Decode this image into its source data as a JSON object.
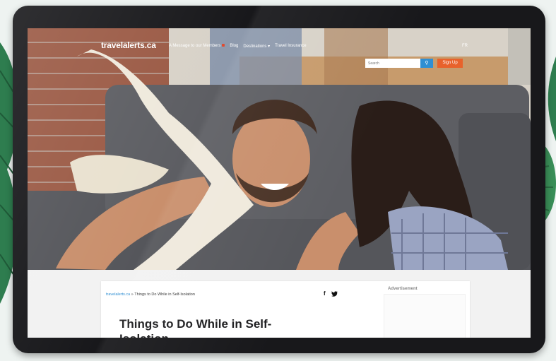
{
  "site": {
    "logo_text": "travelalerts.ca",
    "nav_links": [
      "A Message to our Members",
      "Blog",
      "Destinations",
      "Travel Insurance"
    ],
    "language": "FR",
    "search_placeholder": "Search",
    "search_icon": "magnifier-icon",
    "signup_label": "Sign Up"
  },
  "article": {
    "breadcrumb_home": "travelalerts.ca",
    "breadcrumb_separator": "»",
    "breadcrumb_current": "Things to Do While in Self-Isolation",
    "share_icons": [
      "f",
      "t"
    ],
    "advertisement_label": "Advertisement",
    "title": "Things to Do While in Self-Isolation"
  },
  "colors": {
    "accent_blue": "#2f8fd3",
    "signup_orange": "#e8622b",
    "bezel": "#18181b"
  }
}
